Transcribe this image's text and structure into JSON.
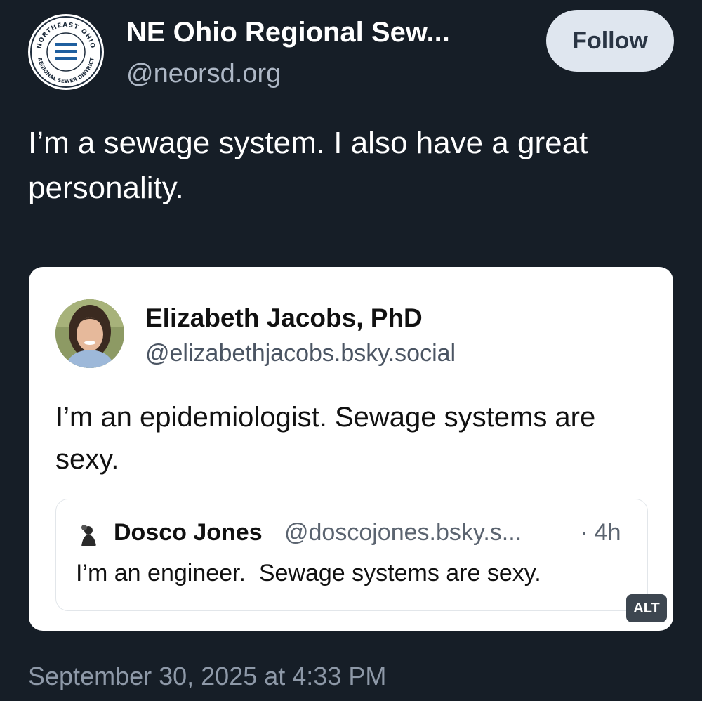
{
  "author": {
    "display_name": "NE Ohio Regional Sew...",
    "handle": "@neorsd.org",
    "logo_text_top": "NORTHEAST OHIO",
    "logo_text_bottom": "REGIONAL SEWER DISTRICT",
    "logo_icon": "water-waves-icon"
  },
  "follow_label": "Follow",
  "post_text": "I’m a sewage system. I also have a great personality.",
  "quote": {
    "display_name": "Elizabeth Jacobs, PhD",
    "handle": "@elizabethjacobs.bsky.social",
    "text": "I’m an epidemiologist. Sewage systems are sexy.",
    "nested": {
      "display_name": "Dosco Jones",
      "handle": "@doscojones.bsky.s...",
      "time": "· 4h",
      "text": "I’m an engineer.  Sewage systems are sexy."
    },
    "alt_badge": "ALT"
  },
  "timestamp": "September 30, 2025 at 4:33 PM",
  "colors": {
    "background": "#161e27",
    "follow_button": "#dfe6ef",
    "logo_blue": "#1f5f9f"
  }
}
